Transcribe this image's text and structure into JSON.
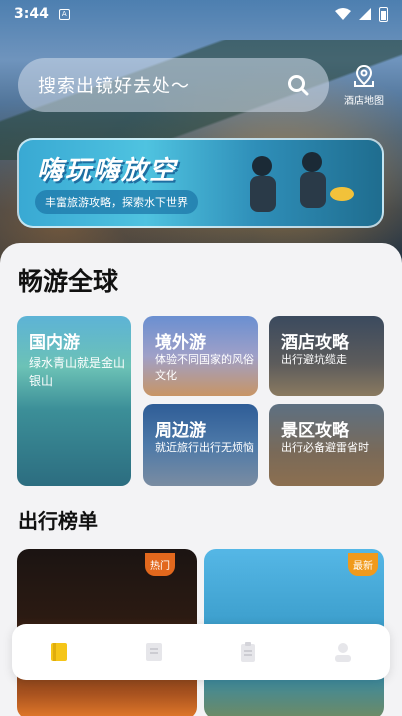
{
  "status_bar": {
    "time": "3:44",
    "notification_glyph": "A"
  },
  "search": {
    "placeholder": "搜索出镜好去处～"
  },
  "hotel_map": {
    "label": "酒店地图"
  },
  "banner": {
    "title": "嗨玩嗨放空",
    "subtitle": "丰富旅游攻略，探索水下世界"
  },
  "section_global": {
    "title": "畅游全球",
    "cards": [
      {
        "title": "国内游",
        "subtitle": "绿水青山就是金山银山"
      },
      {
        "title": "境外游",
        "subtitle": "体验不同国家的风俗文化"
      },
      {
        "title": "酒店攻略",
        "subtitle": "出行避坑缆走"
      },
      {
        "title": "周边游",
        "subtitle": "就近旅行出行无烦恼"
      },
      {
        "title": "景区攻略",
        "subtitle": "出行必备避雷省时"
      }
    ]
  },
  "section_rank": {
    "title": "出行榜单",
    "items": [
      {
        "badge": "热门"
      },
      {
        "badge": "最新"
      }
    ]
  },
  "tabbar": {
    "items": [
      {
        "icon": "book-icon",
        "active": true,
        "color": "#f5c518"
      },
      {
        "icon": "checklist-icon",
        "active": false
      },
      {
        "icon": "clipboard-icon",
        "active": false
      },
      {
        "icon": "profile-icon",
        "active": false
      }
    ]
  }
}
